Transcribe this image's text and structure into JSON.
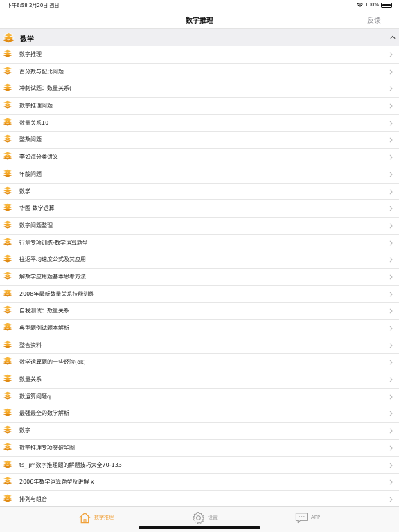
{
  "status_bar": {
    "time_date": "下午6:58   2月20日 週日",
    "battery": "100%",
    "battery_level": 1.0,
    "wifi_icon": "wifi-icon"
  },
  "nav": {
    "title": "数字推理",
    "feedback_label": "反馈"
  },
  "section": {
    "title": "数学",
    "icon": "stack-icon",
    "collapse_icon": "chevron-up-icon"
  },
  "items": [
    {
      "label": "数字推理"
    },
    {
      "label": "百分数与配比问题"
    },
    {
      "label": "冲刺试题：数量关系("
    },
    {
      "label": "数字推理问题"
    },
    {
      "label": "数量关系10"
    },
    {
      "label": "整数问题"
    },
    {
      "label": "李如海分类讲义"
    },
    {
      "label": "年龄问题"
    },
    {
      "label": "数学"
    },
    {
      "label": "华图  数学运算"
    },
    {
      "label": "数字问题整理"
    },
    {
      "label": "行测专项训练-数学运算题型"
    },
    {
      "label": "往返平均速度公式及其应用"
    },
    {
      "label": "解数学应用题基本思考方法"
    },
    {
      "label": "2008年最新数量关系技能训练"
    },
    {
      "label": "自我测试：数量关系"
    },
    {
      "label": "典型题例试题本解析"
    },
    {
      "label": "整合资料"
    },
    {
      "label": "数学运算题的一些经验(ok)"
    },
    {
      "label": "数量关系"
    },
    {
      "label": "数运算问题q"
    },
    {
      "label": "最强最全的数学解析"
    },
    {
      "label": "数字"
    },
    {
      "label": "数字推理专项突破华图"
    },
    {
      "label": "ts_ljm数字推理题的解题技巧大全70-133"
    },
    {
      "label": "2006年数学运算题型及讲解 x"
    },
    {
      "label": "排列与组合"
    }
  ],
  "tabs": [
    {
      "label": "数字推理",
      "icon": "home-icon",
      "active": true
    },
    {
      "label": "设置",
      "icon": "gear-icon",
      "active": false
    },
    {
      "label": "APP",
      "icon": "chat-bubble-icon",
      "active": false
    }
  ],
  "colors": {
    "accent": "#f0a13a",
    "icon_orange": "#f5a623",
    "icon_dark": "#e08a12",
    "inactive": "#999999"
  }
}
